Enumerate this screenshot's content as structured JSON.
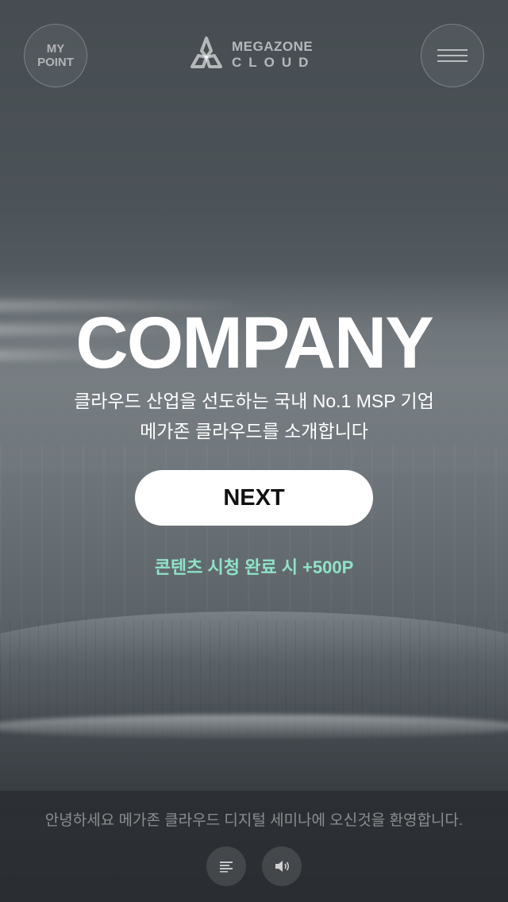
{
  "header": {
    "my_point_line1": "MY",
    "my_point_line2": "POINT",
    "logo_line1": "MEGAZONE",
    "logo_line2": "CLOUD",
    "menu_icon": "hamburger-menu-icon"
  },
  "hero": {
    "title": "COMPANY",
    "subtitle_line1": "클라우드 산업을 선도하는 국내 No.1 MSP 기업",
    "subtitle_line2": "메가존 클라우드를 소개합니다",
    "next_label": "NEXT",
    "reward_text": "콘텐츠 시청 완료 시  +500P",
    "reward_color": "#8fe3c8"
  },
  "bottom": {
    "caption": "안녕하세요 메가존 클라우드 디지털 세미나에 오신것을 환영합니다.",
    "controls": [
      {
        "icon": "script-lines-icon"
      },
      {
        "icon": "speaker-icon"
      }
    ]
  }
}
